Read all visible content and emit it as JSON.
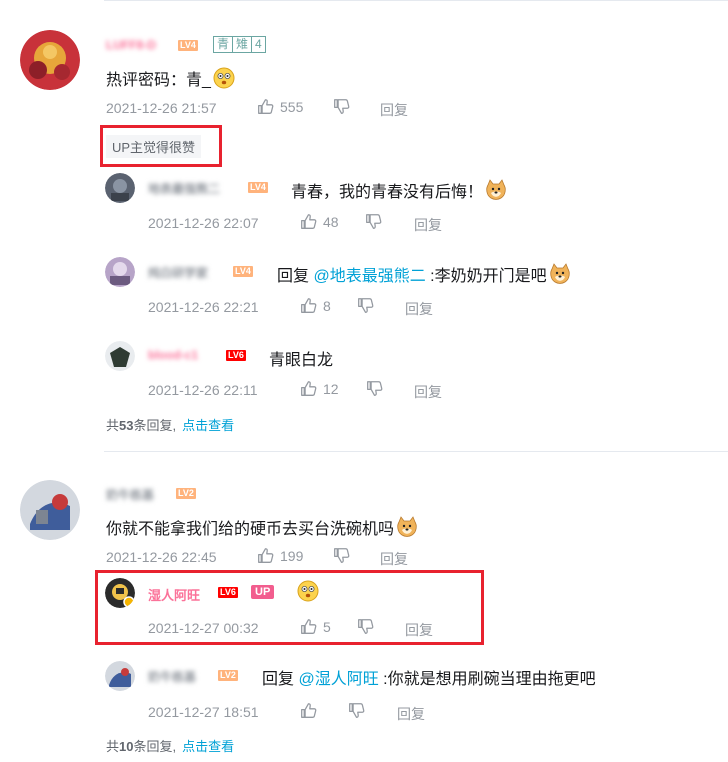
{
  "comment1": {
    "username": "LUFF8-D",
    "fan_badge": [
      "青",
      "雉",
      "4"
    ],
    "text": "热评密码：青_",
    "time": "2021-12-26 21:57",
    "likes": "555",
    "reply_label": "回复",
    "up_liked_label": "UP主觉得很赞",
    "replies": [
      {
        "username": "地表最强熊二",
        "text": "青春，我的青春没有后悔！",
        "time": "2021-12-26 22:07",
        "likes": "48",
        "reply_label": "回复"
      },
      {
        "username": "炖白研学家",
        "reply_prefix": "回复",
        "mention": "@地表最强熊二",
        "text": ":李奶奶开门是吧",
        "time": "2021-12-26 22:21",
        "likes": "8",
        "reply_label": "回复"
      },
      {
        "username": "blood-c1",
        "text": "青眼白龙",
        "time": "2021-12-26 22:11",
        "likes": "12",
        "reply_label": "回复"
      }
    ],
    "more": {
      "prefix": "共",
      "count": "53",
      "suffix": "条回复,",
      "link": "点击查看"
    }
  },
  "comment2": {
    "username": "奶牛栋基",
    "text": "你就不能拿我们给的硬币去买台洗碗机吗",
    "time": "2021-12-26 22:45",
    "likes": "199",
    "reply_label": "回复",
    "replies": [
      {
        "username": "湿人阿旺",
        "level": "LV6",
        "up_tag": "UP",
        "time": "2021-12-27 00:32",
        "likes": "5",
        "reply_label": "回复"
      },
      {
        "username": "奶牛栋基",
        "reply_prefix": "回复",
        "mention": "@湿人阿旺",
        "text": ":你就是想用刷碗当理由拖更吧",
        "time": "2021-12-27 18:51",
        "reply_label": "回复"
      }
    ],
    "more": {
      "prefix": "共",
      "count": "10",
      "suffix": "条回复,",
      "link": "点击查看"
    }
  },
  "levels": {
    "c1": "LV4",
    "r1": "LV4",
    "r2": "LV4",
    "r3": "LV6",
    "c2": "LV2",
    "r5": "LV2"
  },
  "colors": {
    "accent_red": "#e8222f",
    "link": "#00a1d6",
    "up_pink": "#f25d8e",
    "meta": "#9499a0"
  }
}
